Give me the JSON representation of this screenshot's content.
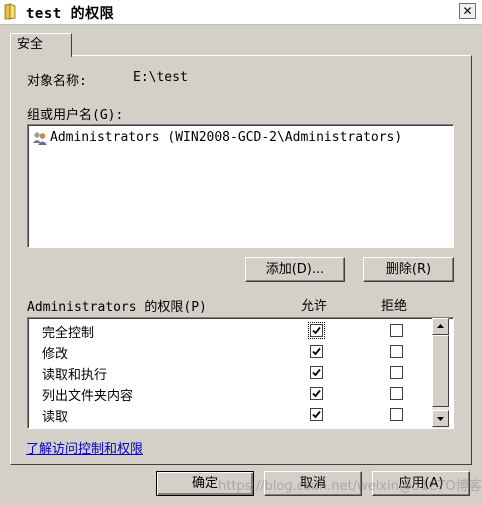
{
  "window": {
    "title": "test 的权限",
    "close_glyph": "✕"
  },
  "tab": {
    "label": "安全"
  },
  "object": {
    "label": "对象名称:",
    "value": "E:\\test"
  },
  "groups": {
    "label": "组或用户名(G):",
    "items": [
      {
        "name": "Administrators (WIN2008-GCD-2\\Administrators)",
        "icon": "users-icon"
      }
    ],
    "add_button": "添加(D)...",
    "remove_button": "删除(R)"
  },
  "permissions": {
    "label": "Administrators 的权限(P)",
    "allow_header": "允许",
    "deny_header": "拒绝",
    "rows": [
      {
        "name": "完全控制",
        "allow": true,
        "deny": false
      },
      {
        "name": "修改",
        "allow": true,
        "deny": false
      },
      {
        "name": "读取和执行",
        "allow": true,
        "deny": false
      },
      {
        "name": "列出文件夹内容",
        "allow": true,
        "deny": false
      },
      {
        "name": "读取",
        "allow": true,
        "deny": false
      }
    ]
  },
  "link": {
    "label": "了解访问控制和权限"
  },
  "footer": {
    "ok": "确定",
    "cancel": "取消",
    "apply": "应用(A)"
  },
  "watermark": "https://blog.csdn.net/weixin@51CTO博客"
}
